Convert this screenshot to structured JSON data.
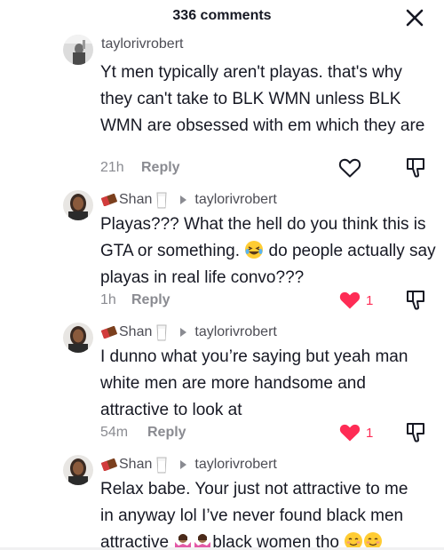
{
  "header": {
    "title": "336 comments"
  },
  "comments": [
    {
      "author": "taylorivrobert",
      "text": "Yt men typically aren't playas. that's why they can't take to BLK WMN unless BLK WMN are obsessed with em which they are",
      "time": "21h",
      "reply_label": "Reply",
      "liked": false,
      "like_count": ""
    },
    {
      "author": "Shan",
      "reply_to": "taylorivrobert",
      "text_before_emoji": "Playas??? What the hell do you think this is GTA or something. ",
      "text_after_emoji": " do people actually say playas in real life convo???",
      "emoji": "laughing-tears-emoji",
      "time": "1h",
      "reply_label": "Reply",
      "liked": true,
      "like_count": "1"
    },
    {
      "author": "Shan",
      "reply_to": "taylorivrobert",
      "text": "I dunno what you’re saying but yeah man white men are more handsome and attractive to look at",
      "time": "54m",
      "reply_label": "Reply",
      "liked": true,
      "like_count": "1"
    },
    {
      "author": "Shan",
      "reply_to": "taylorivrobert",
      "text_line1": "Relax babe. Your just not attractive to me",
      "text_line2": "in anyway lol I’ve never found black men",
      "text_line3_a": "attractive ",
      "text_line3_b": "black women tho ",
      "emojis": [
        "shrugging-woman-emoji",
        "shrugging-woman-emoji",
        "smiling-blush-emoji",
        "smiling-blush-emoji"
      ]
    }
  ],
  "colors": {
    "like_red": "#fe2c55",
    "text": "#161823",
    "muted": "#8a8b91"
  }
}
